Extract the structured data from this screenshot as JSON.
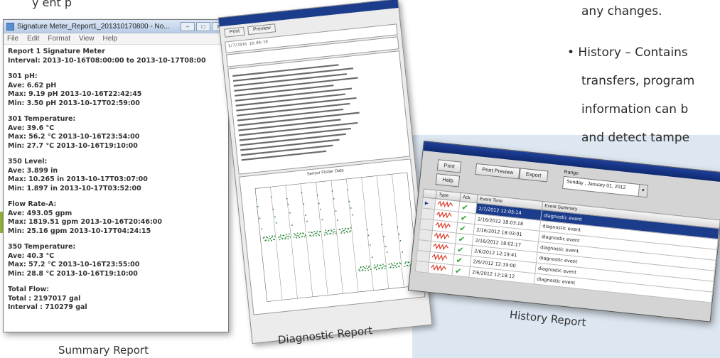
{
  "top_caption": "y   ent   p",
  "bullets": {
    "line0": "any changes.",
    "line1": "• History – Contains",
    "line2": "transfers, program",
    "line3": "information can b",
    "line4": "and detect tampe"
  },
  "captions": {
    "summary": "Summary Report",
    "diagnostic": "Diagnostic Report",
    "history": "History Report"
  },
  "summary_window": {
    "title": "Signature Meter_Report1_201310170800 - No...",
    "menu": [
      "File",
      "Edit",
      "Format",
      "View",
      "Help"
    ],
    "lines": {
      "l1": "Report 1  Signature Meter",
      "l2": "Interval: 2013-10-16T08:00:00 to 2013-10-17T08:00",
      "l3": "301 pH:",
      "l4": "Ave: 6.62 pH",
      "l5": "Max: 9.19 pH 2013-10-16T22:42:45",
      "l6": "Min: 3.50 pH 2013-10-17T02:59:00",
      "l7": "301 Temperature:",
      "l8": "Ave: 39.6 °C",
      "l9": "Max: 56.2 °C 2013-10-16T23:54:00",
      "l10": "Min: 27.7 °C 2013-10-16T19:10:00",
      "l11": "350 Level:",
      "l12": "Ave:  3.899 in",
      "l13": "Max:  10.265 in 2013-10-17T03:07:00",
      "l14": "Min:  1.897 in 2013-10-17T03:52:00",
      "l15": "Flow Rate-A:",
      "l16": "Ave: 493.05 gpm",
      "l17": "Max: 1819.51 gpm 2013-10-16T20:46:00",
      "l18": "Min: 25.16 gpm 2013-10-17T04:24:15",
      "l19": "350 Temperature:",
      "l20": "Ave: 40.3 °C",
      "l21": "Max: 57.2 °C 2013-10-16T23:55:00",
      "l22": "Min: 28.8 °C 2013-10-16T19:10:00",
      "l23": "Total Flow:",
      "l24": "Total :   2197017 gal",
      "l25": "Interval :  710279 gal"
    }
  },
  "diagnostic_window": {
    "buttons": [
      "Print",
      "Preview"
    ],
    "header_line": "1/7/2016 10:00:19",
    "chart_title": "Sensor Flutter Data"
  },
  "history_window": {
    "buttons": {
      "print": "Print",
      "print_preview": "Print Preview",
      "export": "Export",
      "help": "Help"
    },
    "range_label": "Range",
    "range_value": "Sunday  ,  January  01, 2012",
    "columns": [
      "Type",
      "Ack",
      "Event Time",
      "Event Summary"
    ],
    "rows": [
      {
        "time": "2/7/2012 12:05:14",
        "summary": "diagnostic event"
      },
      {
        "time": "2/16/2012 18:03:18",
        "summary": "diagnostic event"
      },
      {
        "time": "2/16/2012 18:03:01",
        "summary": "diagnostic event"
      },
      {
        "time": "2/16/2012 18:02:17",
        "summary": "diagnostic event"
      },
      {
        "time": "2/6/2012 12:19:41",
        "summary": "diagnostic event"
      },
      {
        "time": "2/6/2012 12:19:00",
        "summary": "diagnostic event"
      },
      {
        "time": "2/6/2012 12:18:12",
        "summary": "diagnostic event"
      }
    ]
  },
  "colors": {
    "accent_green": "#8fb43a",
    "bg_panel": "#dde7f1",
    "title_blue": "#1c3c8c",
    "check_green": "#2ea12e",
    "plot_green": "#2a8a3a"
  }
}
